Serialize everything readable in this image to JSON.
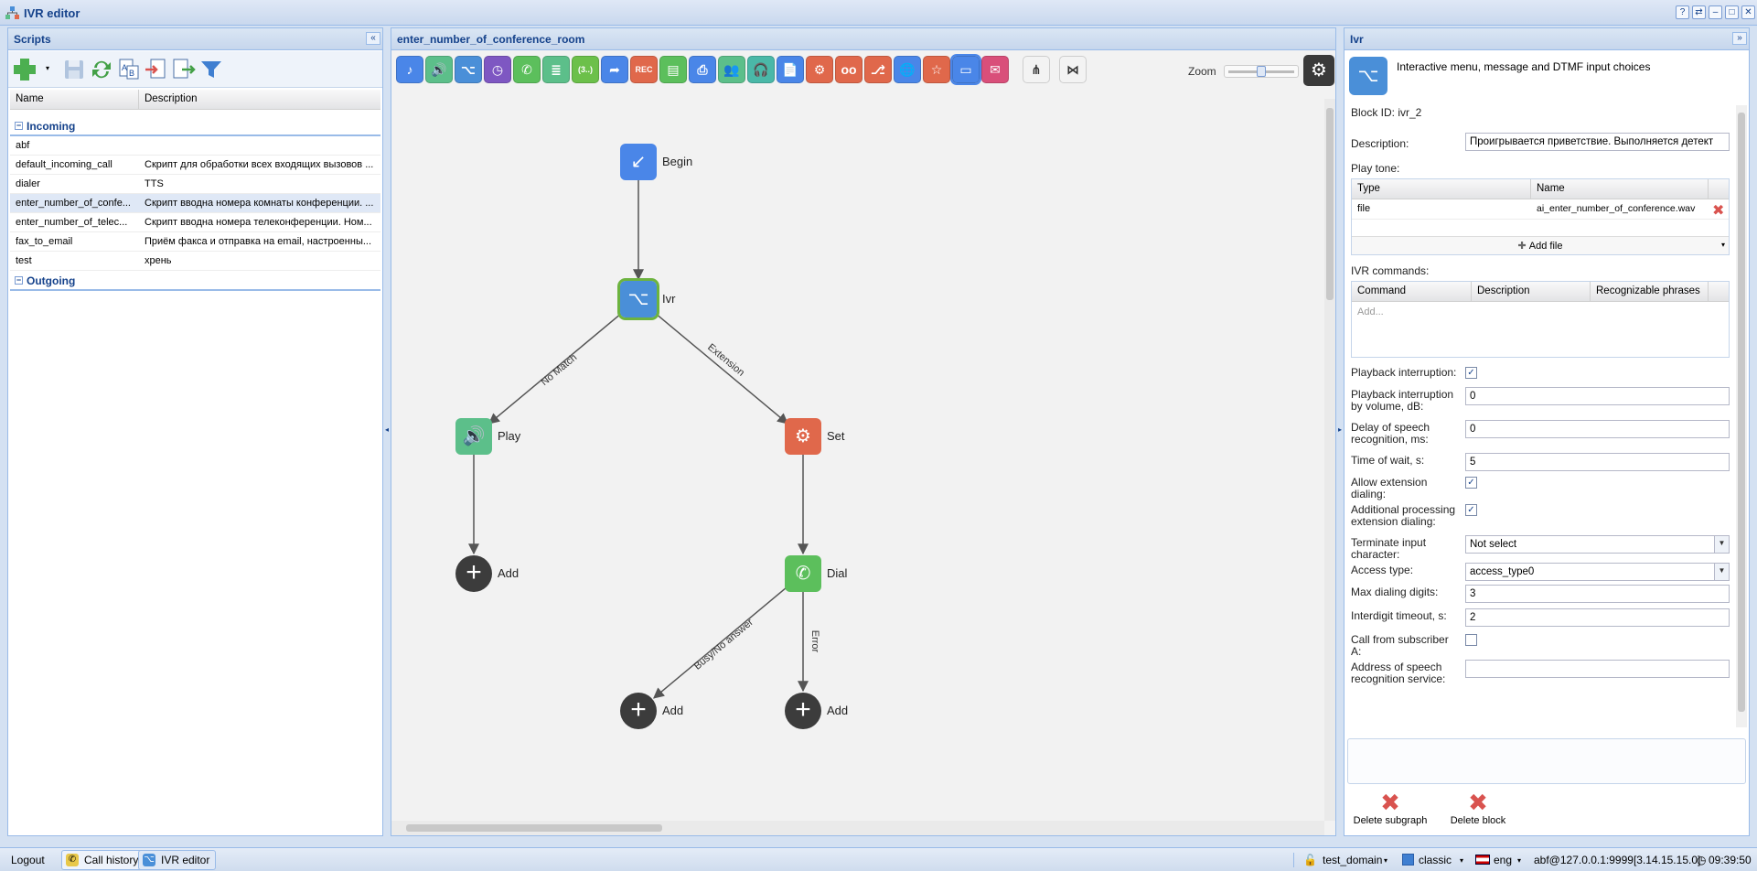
{
  "window": {
    "title": "IVR editor",
    "controls": [
      "?",
      "⇄",
      "–",
      "□",
      "✕"
    ]
  },
  "scripts": {
    "title": "Scripts",
    "columns": [
      "Name",
      "Description"
    ],
    "groups": [
      {
        "label": "Incoming",
        "rows": [
          {
            "name": "abf",
            "desc": ""
          },
          {
            "name": "default_incoming_call",
            "desc": "Скрипт для обработки всех входящих вызовов ..."
          },
          {
            "name": "dialer",
            "desc": "TTS"
          },
          {
            "name": "enter_number_of_confe...",
            "desc": "Скрипт вводна номера комнаты конференции. ..."
          },
          {
            "name": "enter_number_of_telec...",
            "desc": "Скрипт вводна номера телеконференции. Ном..."
          },
          {
            "name": "fax_to_email",
            "desc": "Приём факса и отправка на email, настроенны..."
          },
          {
            "name": "test",
            "desc": "хрень"
          }
        ]
      },
      {
        "label": "Outgoing",
        "rows": []
      }
    ]
  },
  "canvas": {
    "title": "enter_number_of_conference_room",
    "zoom_label": "Zoom",
    "palette": [
      {
        "icon": "music-icon",
        "color": "#4a86e8",
        "glyph": "♪"
      },
      {
        "icon": "speaker-icon",
        "color": "#5cbf8a",
        "glyph": "🔊"
      },
      {
        "icon": "ivr-icon",
        "color": "#4a8fd8",
        "glyph": "⌥"
      },
      {
        "icon": "clock-icon",
        "color": "#7e57c2",
        "glyph": "◷"
      },
      {
        "icon": "phone-icon",
        "color": "#5cbf5c",
        "glyph": "✆"
      },
      {
        "icon": "list-icon",
        "color": "#5cbf8a",
        "glyph": "≣"
      },
      {
        "icon": "number-icon",
        "color": "#6cc04a",
        "glyph": "(3..)"
      },
      {
        "icon": "redirect-icon",
        "color": "#4a86e8",
        "glyph": "➦"
      },
      {
        "icon": "record-icon",
        "color": "#e0684b",
        "glyph": "REC"
      },
      {
        "icon": "form-icon",
        "color": "#5cbf5c",
        "glyph": "▤"
      },
      {
        "icon": "fax-icon",
        "color": "#4a86e8",
        "glyph": "⎙"
      },
      {
        "icon": "conference-icon",
        "color": "#5cbf8a",
        "glyph": "👥"
      },
      {
        "icon": "headset-icon",
        "color": "#4ab8a8",
        "glyph": "🎧"
      },
      {
        "icon": "document-icon",
        "color": "#4a86e8",
        "glyph": "📄"
      },
      {
        "icon": "gear-icon",
        "color": "#e0684b",
        "glyph": "⚙"
      },
      {
        "icon": "voicemail-icon",
        "color": "#e0684b",
        "glyph": "oo"
      },
      {
        "icon": "branch-icon",
        "color": "#e0684b",
        "glyph": "⎇"
      },
      {
        "icon": "globe-icon",
        "color": "#4a86e8",
        "glyph": "🌐"
      },
      {
        "icon": "star-icon",
        "color": "#e0684b",
        "glyph": "☆"
      },
      {
        "icon": "tts-icon",
        "color": "#4a86e8",
        "glyph": "▭"
      },
      {
        "icon": "email-icon",
        "color": "#d94f7a",
        "glyph": "✉"
      },
      {
        "icon": "subgraph-lock-icon",
        "color": "#f3f3f3",
        "glyph": "⋔"
      },
      {
        "icon": "subgraph-icon",
        "color": "#f3f3f3",
        "glyph": "⋈"
      }
    ],
    "nodes": [
      {
        "id": "begin",
        "label": "Begin",
        "type": "begin",
        "color": "#4a86e8",
        "glyph": "↙"
      },
      {
        "id": "ivr",
        "label": "Ivr",
        "type": "ivr",
        "color": "#4a8fd8",
        "glyph": "⌥"
      },
      {
        "id": "play",
        "label": "Play",
        "type": "play",
        "color": "#5cbf8a",
        "glyph": "🔊"
      },
      {
        "id": "set",
        "label": "Set",
        "type": "set",
        "color": "#e0684b",
        "glyph": "⚙"
      },
      {
        "id": "add1",
        "label": "Add",
        "type": "add"
      },
      {
        "id": "dial",
        "label": "Dial",
        "type": "dial",
        "color": "#5cbf5c",
        "glyph": "✆"
      },
      {
        "id": "add2",
        "label": "Add",
        "type": "add"
      },
      {
        "id": "add3",
        "label": "Add",
        "type": "add"
      }
    ],
    "edges": [
      {
        "from": "begin",
        "to": "ivr",
        "label": ""
      },
      {
        "from": "ivr",
        "to": "play",
        "label": "No Match"
      },
      {
        "from": "ivr",
        "to": "set",
        "label": "Extension"
      },
      {
        "from": "play",
        "to": "add1",
        "label": ""
      },
      {
        "from": "set",
        "to": "dial",
        "label": ""
      },
      {
        "from": "dial",
        "to": "add2",
        "label": "Busy/No answer"
      },
      {
        "from": "dial",
        "to": "add3",
        "label": "Error"
      }
    ]
  },
  "props": {
    "title": "Ivr",
    "subtitle": "Interactive menu, message and DTMF input choices",
    "block_id": "Block ID: ivr_2",
    "description_label": "Description:",
    "description_value": "Проигрывается приветствие. Выполняется детект",
    "play_tone_label": "Play tone:",
    "tone_columns": [
      "Type",
      "Name"
    ],
    "tone_rows": [
      {
        "type": "file",
        "name": "ai_enter_number_of_conference.wav"
      }
    ],
    "add_file": "Add file",
    "ivr_commands_label": "IVR commands:",
    "cmd_columns": [
      "Command",
      "Description",
      "Recognizable phrases"
    ],
    "cmd_placeholder": "Add...",
    "fields": [
      {
        "label": "Playback interruption:",
        "kind": "check",
        "checked": true
      },
      {
        "label": "Playback interruption by volume, dB:",
        "kind": "text",
        "value": "0"
      },
      {
        "label": "Delay of speech recognition, ms:",
        "kind": "text",
        "value": "0"
      },
      {
        "label": "Time of wait, s:",
        "kind": "text",
        "value": "5"
      },
      {
        "label": "Allow extension dialing:",
        "kind": "check",
        "checked": true
      },
      {
        "label": "Additional processing extension dialing:",
        "kind": "check",
        "checked": true
      },
      {
        "label": "Terminate input character:",
        "kind": "select",
        "value": "Not select"
      },
      {
        "label": "Access type:",
        "kind": "select",
        "value": "access_type0"
      },
      {
        "label": "Max dialing digits:",
        "kind": "text",
        "value": "3"
      },
      {
        "label": "Interdigit timeout, s:",
        "kind": "text",
        "value": "2"
      },
      {
        "label": "Call from subscriber A:",
        "kind": "check",
        "checked": false
      },
      {
        "label": "Address of speech recognition service:",
        "kind": "text",
        "value": ""
      }
    ],
    "delete_subgraph": "Delete subgraph",
    "delete_block": "Delete block"
  },
  "statusbar": {
    "logout": "Logout",
    "tasks": [
      {
        "label": "Call history",
        "icon": "call-history-icon"
      },
      {
        "label": "IVR editor",
        "icon": "ivr-editor-icon"
      }
    ],
    "domain": "test_domain",
    "theme": "classic",
    "lang": "eng",
    "user": "abf@127.0.0.1:9999[3.14.15.15.0]",
    "time": "09:39:50"
  }
}
